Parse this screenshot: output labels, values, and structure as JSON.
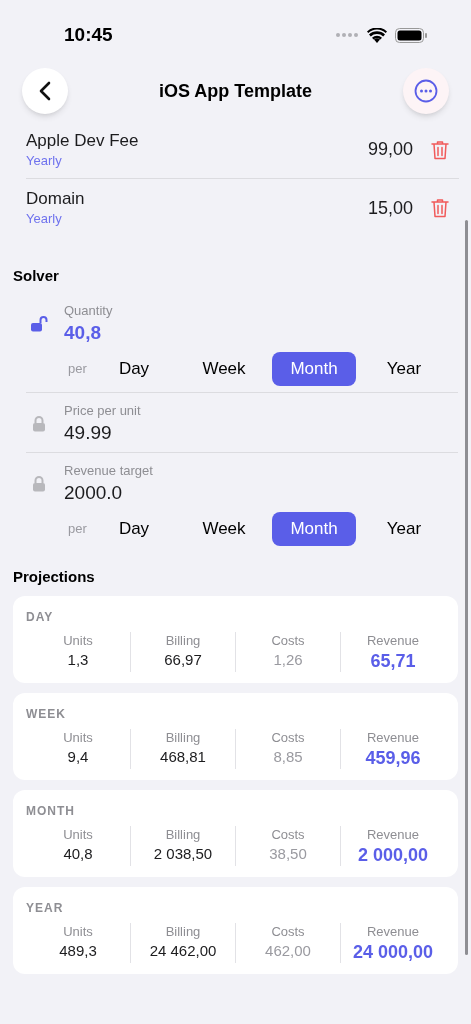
{
  "status_bar": {
    "time": "10:45"
  },
  "nav": {
    "title": "iOS App Template"
  },
  "costs": [
    {
      "name": "Apple Dev Fee",
      "period": "Yearly",
      "amount": "99,00"
    },
    {
      "name": "Domain",
      "period": "Yearly",
      "amount": "15,00"
    }
  ],
  "solver": {
    "title": "Solver",
    "fields": [
      {
        "label": "Quantity",
        "value": "40,8",
        "locked": false,
        "per_label": "per",
        "periods": [
          {
            "label": "Day",
            "selected": false
          },
          {
            "label": "Week",
            "selected": false
          },
          {
            "label": "Month",
            "selected": true
          },
          {
            "label": "Year",
            "selected": false
          }
        ]
      },
      {
        "label": "Price per unit",
        "value": "49.99",
        "locked": true
      },
      {
        "label": "Revenue target",
        "value": "2000.0",
        "locked": true,
        "per_label": "per",
        "periods": [
          {
            "label": "Day",
            "selected": false
          },
          {
            "label": "Week",
            "selected": false
          },
          {
            "label": "Month",
            "selected": true
          },
          {
            "label": "Year",
            "selected": false
          }
        ]
      }
    ]
  },
  "projections": {
    "title": "Projections",
    "cards": [
      {
        "period": "DAY",
        "metrics": [
          {
            "kind": "units",
            "label": "Units",
            "value": "1,3"
          },
          {
            "kind": "billing",
            "label": "Billing",
            "value": "66,97"
          },
          {
            "kind": "costs",
            "label": "Costs",
            "value": "1,26"
          },
          {
            "kind": "revenue",
            "label": "Revenue",
            "value": "65,71"
          }
        ]
      },
      {
        "period": "WEEK",
        "metrics": [
          {
            "kind": "units",
            "label": "Units",
            "value": "9,4"
          },
          {
            "kind": "billing",
            "label": "Billing",
            "value": "468,81"
          },
          {
            "kind": "costs",
            "label": "Costs",
            "value": "8,85"
          },
          {
            "kind": "revenue",
            "label": "Revenue",
            "value": "459,96"
          }
        ]
      },
      {
        "period": "MONTH",
        "metrics": [
          {
            "kind": "units",
            "label": "Units",
            "value": "40,8"
          },
          {
            "kind": "billing",
            "label": "Billing",
            "value": "2 038,50"
          },
          {
            "kind": "costs",
            "label": "Costs",
            "value": "38,50"
          },
          {
            "kind": "revenue",
            "label": "Revenue",
            "value": "2 000,00"
          }
        ]
      },
      {
        "period": "YEAR",
        "metrics": [
          {
            "kind": "units",
            "label": "Units",
            "value": "489,3"
          },
          {
            "kind": "billing",
            "label": "Billing",
            "value": "24 462,00"
          },
          {
            "kind": "costs",
            "label": "Costs",
            "value": "462,00"
          },
          {
            "kind": "revenue",
            "label": "Revenue",
            "value": "24 000,00"
          }
        ]
      }
    ]
  }
}
